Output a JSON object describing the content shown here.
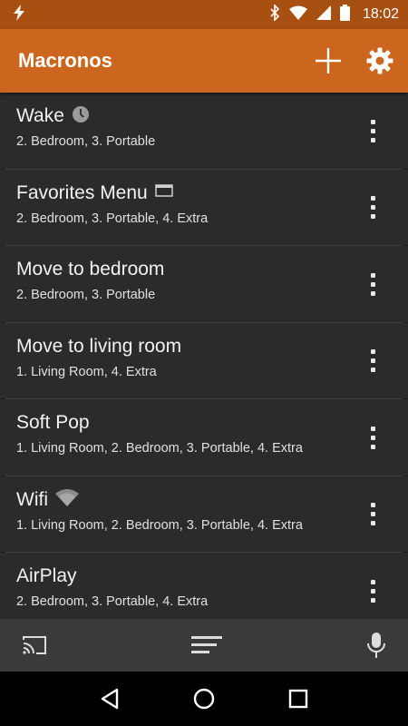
{
  "status_bar": {
    "time": "18:02",
    "icons": [
      "flash-icon",
      "bluetooth-icon",
      "wifi-signal-icon",
      "cell-signal-icon",
      "battery-icon"
    ]
  },
  "app_bar": {
    "title": "Macronos",
    "actions": [
      "add-icon",
      "settings-icon"
    ],
    "background": "#cc651d"
  },
  "macros": [
    {
      "title": "Wake",
      "subtitle": "2. Bedroom, 3. Portable",
      "badge_icon": "clock-icon"
    },
    {
      "title": "Favorites Menu",
      "subtitle": "2. Bedroom, 3. Portable, 4. Extra",
      "badge_icon": "window-icon"
    },
    {
      "title": "Move to bedroom",
      "subtitle": "2. Bedroom, 3. Portable",
      "badge_icon": ""
    },
    {
      "title": "Move to living room",
      "subtitle": "1. Living Room, 4. Extra",
      "badge_icon": ""
    },
    {
      "title": "Soft Pop",
      "subtitle": "1. Living Room, 2. Bedroom, 3. Portable, 4. Extra",
      "badge_icon": ""
    },
    {
      "title": "Wifi",
      "subtitle": "1. Living Room, 2. Bedroom, 3. Portable, 4. Extra",
      "badge_icon": "wifi-icon"
    },
    {
      "title": "AirPlay",
      "subtitle": "2. Bedroom, 3. Portable, 4. Extra",
      "badge_icon": ""
    }
  ],
  "bottom_bar": {
    "icons": [
      "cast-icon",
      "queue-icon",
      "microphone-icon"
    ]
  },
  "nav_bar": {
    "icons": [
      "back-icon",
      "home-icon",
      "recents-icon"
    ]
  }
}
